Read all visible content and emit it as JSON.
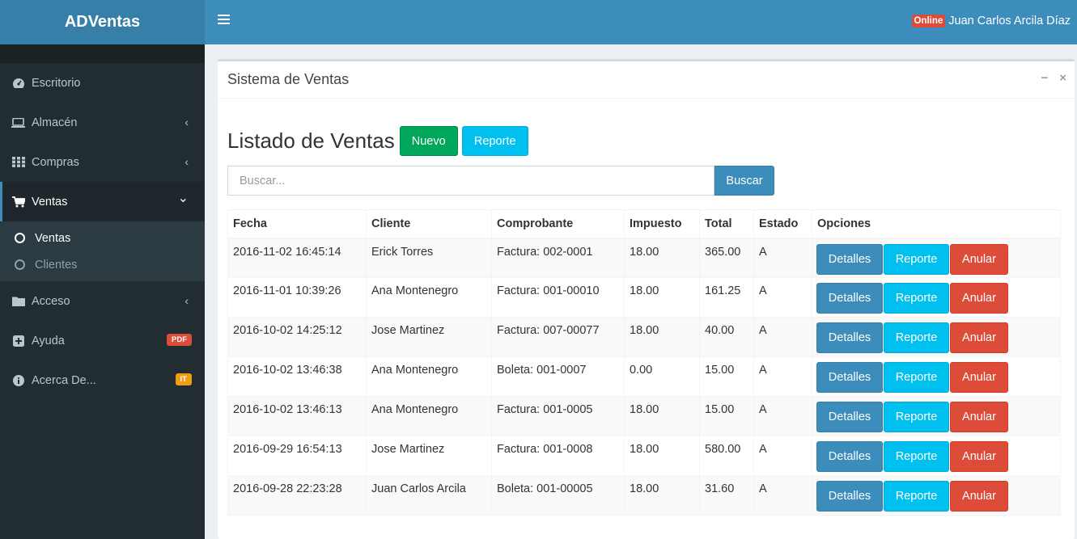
{
  "app": {
    "brand": "ADVentas"
  },
  "header": {
    "online_badge": "Online",
    "user_name": "Juan Carlos Arcila Díaz"
  },
  "sidebar": {
    "items": [
      {
        "label": "Escritorio",
        "icon": "dashboard-icon"
      },
      {
        "label": "Almacén",
        "icon": "laptop-icon",
        "chevron": "‹"
      },
      {
        "label": "Compras",
        "icon": "grid-icon",
        "chevron": "‹"
      },
      {
        "label": "Ventas",
        "icon": "cart-icon",
        "chevron": "⌄"
      },
      {
        "label": "Acceso",
        "icon": "folder-icon",
        "chevron": "‹"
      },
      {
        "label": "Ayuda",
        "icon": "plus-square-icon",
        "badge": "PDF",
        "badge_color": "#dd4b39"
      },
      {
        "label": "Acerca De...",
        "icon": "info-icon",
        "badge": "IT",
        "badge_color": "#f39c12"
      }
    ],
    "ventas_sub": [
      {
        "label": "Ventas"
      },
      {
        "label": "Clientes"
      }
    ]
  },
  "box": {
    "title": "Sistema de Ventas",
    "minimize": "−",
    "close": "×"
  },
  "page": {
    "heading": "Listado de Ventas",
    "new_button": "Nuevo",
    "report_button": "Reporte",
    "search_placeholder": "Buscar...",
    "search_button": "Buscar"
  },
  "table": {
    "headers": [
      "Fecha",
      "Cliente",
      "Comprobante",
      "Impuesto",
      "Total",
      "Estado",
      "Opciones"
    ],
    "action_labels": {
      "details": "Detalles",
      "report": "Reporte",
      "cancel": "Anular"
    },
    "rows": [
      {
        "fecha": "2016-11-02 16:45:14",
        "cliente": "Erick Torres",
        "comprobante": "Factura: 002-0001",
        "impuesto": "18.00",
        "total": "365.00",
        "estado": "A"
      },
      {
        "fecha": "2016-11-01 10:39:26",
        "cliente": "Ana Montenegro",
        "comprobante": "Factura: 001-00010",
        "impuesto": "18.00",
        "total": "161.25",
        "estado": "A"
      },
      {
        "fecha": "2016-10-02 14:25:12",
        "cliente": "Jose Martinez",
        "comprobante": "Factura: 007-00077",
        "impuesto": "18.00",
        "total": "40.00",
        "estado": "A"
      },
      {
        "fecha": "2016-10-02 13:46:38",
        "cliente": "Ana Montenegro",
        "comprobante": "Boleta: 001-0007",
        "impuesto": "0.00",
        "total": "15.00",
        "estado": "A"
      },
      {
        "fecha": "2016-10-02 13:46:13",
        "cliente": "Ana Montenegro",
        "comprobante": "Factura: 001-0005",
        "impuesto": "18.00",
        "total": "15.00",
        "estado": "A"
      },
      {
        "fecha": "2016-09-29 16:54:13",
        "cliente": "Jose Martinez",
        "comprobante": "Factura: 001-0008",
        "impuesto": "18.00",
        "total": "580.00",
        "estado": "A"
      },
      {
        "fecha": "2016-09-28 22:23:28",
        "cliente": "Juan Carlos Arcila",
        "comprobante": "Boleta: 001-00005",
        "impuesto": "18.00",
        "total": "31.60",
        "estado": "A"
      }
    ]
  }
}
